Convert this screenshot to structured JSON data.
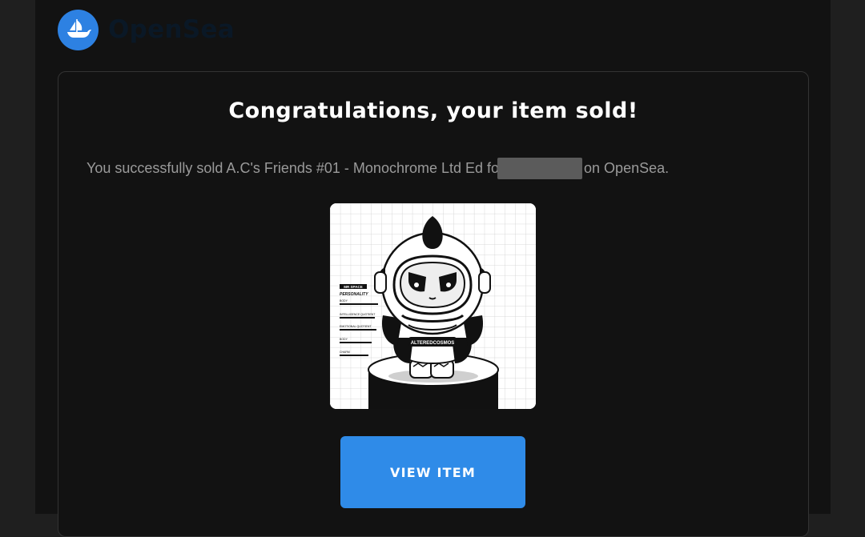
{
  "brand": {
    "name": "OpenSea",
    "accent_color": "#2d81e2"
  },
  "email": {
    "headline": "Congratulations, your item sold!",
    "message_before": "You successfully sold A.C's Friends #01 - Monochrome Ltd Ed for",
    "message_after": "on OpenSea.",
    "redacted_price": true
  },
  "item": {
    "image_icon": "nft-astronaut-image",
    "nft_labels": {
      "name_tag": "MR SPACE",
      "personality": "PERSONALITY",
      "stat_1": "BODY",
      "stat_2": "INTELLIGENCE QUOTIENT",
      "stat_3": "EMOTIONAL QUOTIENT",
      "stat_4": "BODY",
      "stat_5": "CHARM",
      "belt": "ALTEREDCOSMOS"
    }
  },
  "actions": {
    "view_item_label": "VIEW ITEM",
    "button_color": "#2f8be8"
  }
}
